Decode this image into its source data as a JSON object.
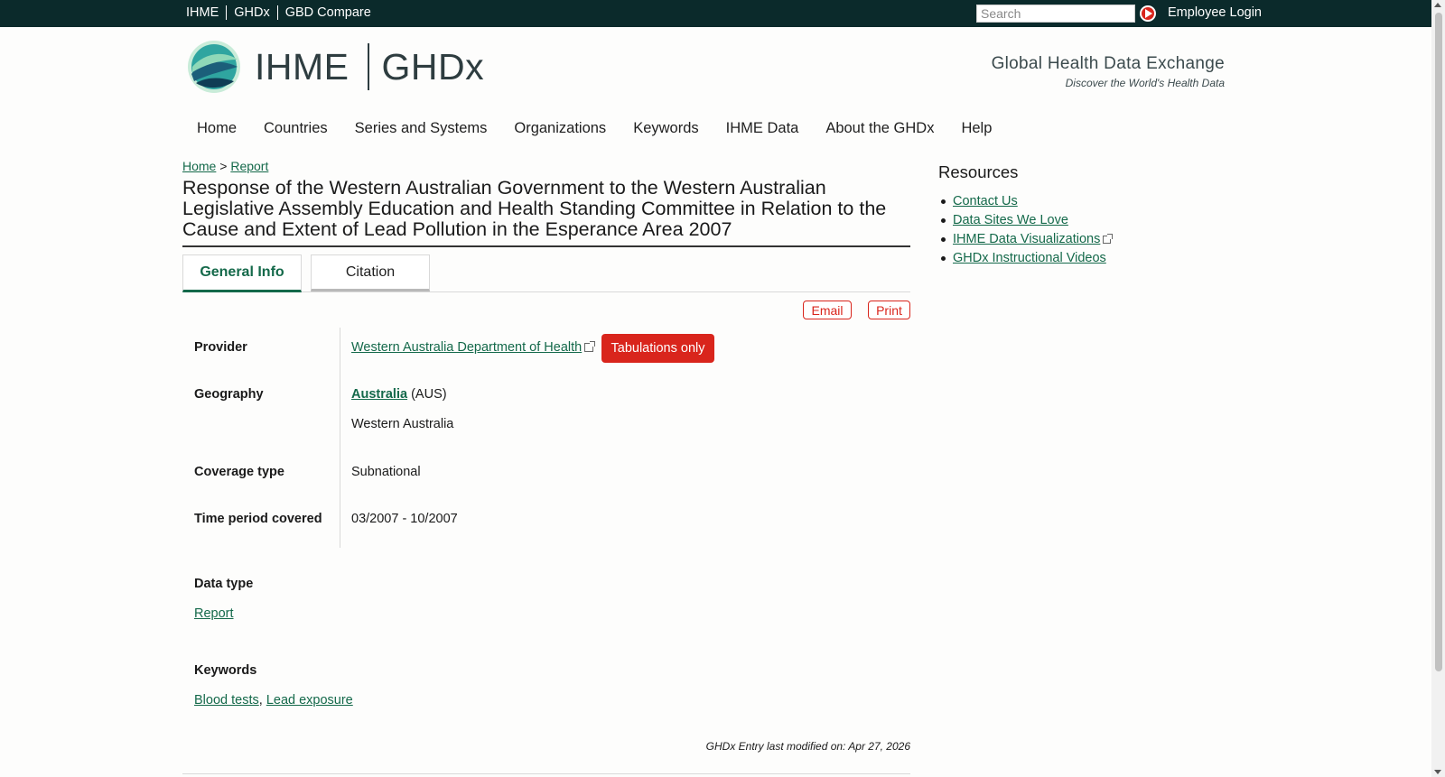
{
  "topbar": {
    "links": [
      "IHME",
      "GHDx",
      "GBD Compare"
    ],
    "search_placeholder": "Search",
    "employee_login": "Employee Login"
  },
  "header": {
    "logo_left": "IHME",
    "logo_right": "GHDx",
    "tagline_title": "Global Health Data Exchange",
    "tagline_sub": "Discover the World's Health Data"
  },
  "nav": [
    "Home",
    "Countries",
    "Series and Systems",
    "Organizations",
    "Keywords",
    "IHME Data",
    "About the GHDx",
    "Help"
  ],
  "breadcrumb": {
    "home": "Home",
    "sep": ">",
    "current": "Report"
  },
  "page_title": "Response of the Western Australian Government to the Western Australian Legislative Assembly Education and Health Standing Committee in Relation to the Cause and Extent of Lead Pollution in the Esperance Area 2007",
  "tabs": {
    "general": "General Info",
    "citation": "Citation"
  },
  "actions": {
    "email": "Email",
    "print": "Print"
  },
  "info": {
    "provider_label": "Provider",
    "provider_value": "Western Australia Department of Health",
    "provider_badge": "Tabulations only",
    "geography_label": "Geography",
    "geography_country": "Australia",
    "geography_code": "(AUS)",
    "geography_region": "Western Australia",
    "coverage_label": "Coverage type",
    "coverage_value": "Subnational",
    "time_label": "Time period covered",
    "time_value": "03/2007 - 10/2007",
    "datatype_label": "Data type",
    "datatype_value": "Report",
    "keywords_label": "Keywords",
    "keyword_1": "Blood tests",
    "keyword_sep": ",",
    "keyword_2": "Lead exposure",
    "modified": "GHDx Entry last modified on: Apr 27, 2026"
  },
  "resources": {
    "title": "Resources",
    "items": [
      "Contact Us",
      "Data Sites We Love",
      "IHME Data Visualizations",
      "GHDx Instructional Videos"
    ]
  },
  "colors": {
    "topbar": "#0b2a2b",
    "link": "#14694a",
    "accent_red": "#d9251c"
  }
}
